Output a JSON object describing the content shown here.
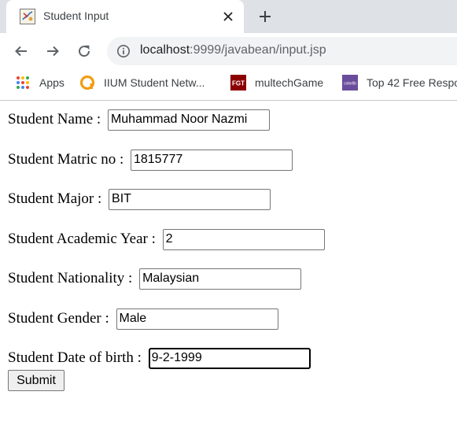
{
  "browser": {
    "tab": {
      "title": "Student Input",
      "favicon": "java-icon"
    },
    "new_tab_icon": "plus-icon",
    "address": {
      "host": "localhost",
      "rest": ":9999/javabean/input.jsp"
    },
    "bookmarks": [
      {
        "label": "Apps",
        "icon": "apps-grid-icon"
      },
      {
        "label": "IIUM Student Netw...",
        "icon": "iium-icon"
      },
      {
        "label": "multechGame",
        "icon": "fgt-icon",
        "icon_text": "FGT"
      },
      {
        "label": "Top 42 Free Respo",
        "icon": "colorlib-icon",
        "icon_text": "colorlib"
      }
    ]
  },
  "form": {
    "fields": [
      {
        "label": "Student Name : ",
        "value": "Muhammad Noor Nazmi"
      },
      {
        "label": "Student Matric no : ",
        "value": "1815777"
      },
      {
        "label": "Student Major : ",
        "value": "BIT"
      },
      {
        "label": "Student Academic Year : ",
        "value": "2"
      },
      {
        "label": "Student Nationality : ",
        "value": "Malaysian"
      },
      {
        "label": "Student Gender : ",
        "value": "Male"
      },
      {
        "label": "Student Date of birth : ",
        "value": "9-2-1999"
      }
    ],
    "submit_label": "Submit"
  },
  "colors": {
    "chrome_bg": "#dee1e6",
    "omnibox_bg": "#f1f3f4",
    "iium_orange": "#f39c12",
    "fgt_red": "#8b0000",
    "colorlib_purple": "#6a4c9c"
  }
}
